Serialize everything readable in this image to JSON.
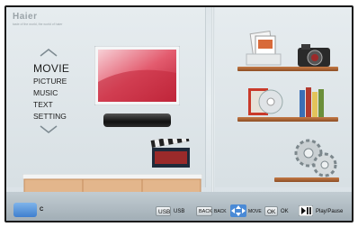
{
  "brand": {
    "logo_text": "Haier",
    "tagline": "taste of the world, the world of haier"
  },
  "menu": {
    "items": [
      {
        "label": "MOVIE",
        "active": true
      },
      {
        "label": "PICTURE",
        "active": false
      },
      {
        "label": "MUSIC",
        "active": false
      },
      {
        "label": "TEXT",
        "active": false
      },
      {
        "label": "SETTING",
        "active": false
      }
    ]
  },
  "footer": {
    "input_label": "C",
    "hints": [
      {
        "key": "USB",
        "text": "USB"
      },
      {
        "key": "BACK",
        "text": "BACK"
      },
      {
        "key": "move-arrows-icon",
        "text": "MOVE"
      },
      {
        "key": "OK",
        "text": "OK"
      },
      {
        "key": "play-pause-icon",
        "text": "Play/Pause"
      }
    ]
  },
  "icons": [
    "tv-icon",
    "soundbar-icon",
    "clapperboard-icon",
    "document-stack-icon",
    "camera-icon",
    "disc-icon",
    "books-icon",
    "gears-icon",
    "input-source-icon"
  ],
  "colors": {
    "shelf": "#a7602f",
    "accent_blue": "#4a8ad6",
    "background": "#e3e9ec"
  }
}
